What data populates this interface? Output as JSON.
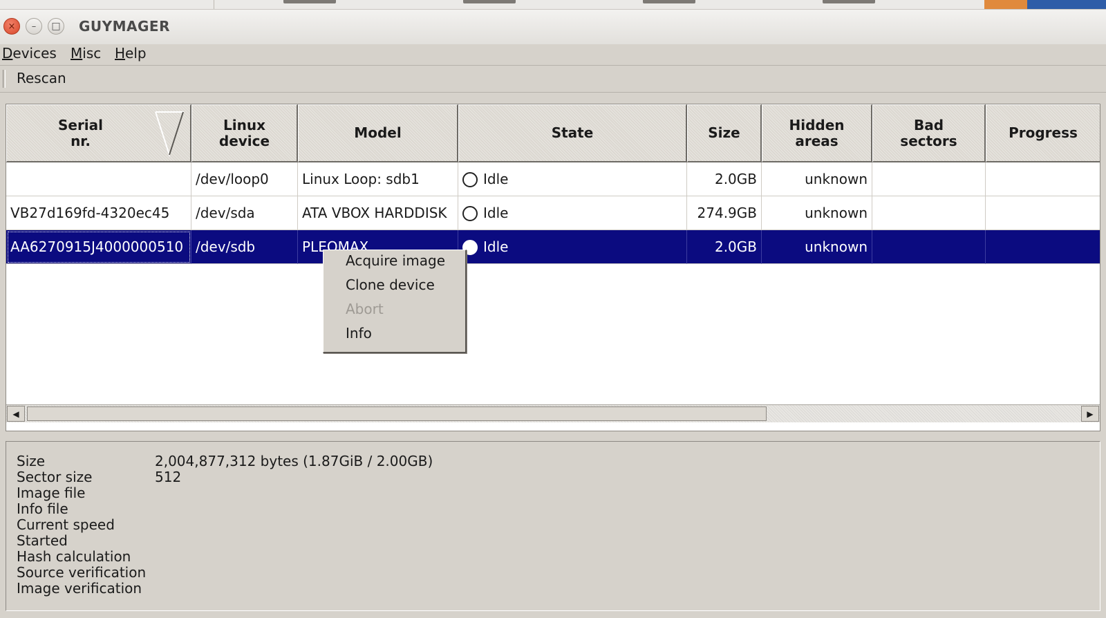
{
  "window": {
    "title": "GUYMAGER",
    "close_icon": "×",
    "min_icon": "–",
    "max_icon": "□"
  },
  "menubar": [
    {
      "first": "D",
      "rest": "evices"
    },
    {
      "first": "M",
      "rest": "isc"
    },
    {
      "first": "H",
      "rest": "elp"
    }
  ],
  "toolbar": {
    "rescan_label": "Rescan"
  },
  "table": {
    "headers": {
      "serial": "Serial\nnr.",
      "linux_device": "Linux\ndevice",
      "model": "Model",
      "state": "State",
      "size": "Size",
      "hidden_areas": "Hidden\nareas",
      "bad_sectors": "Bad\nsectors",
      "progress": "Progress"
    },
    "rows": [
      {
        "serial": "",
        "device": "/dev/loop0",
        "model": "Linux Loop: sdb1",
        "state": "Idle",
        "size": "2.0GB",
        "hidden": "unknown",
        "bad": "",
        "progress": ""
      },
      {
        "serial": "VB27d169fd-4320ec45",
        "device": "/dev/sda",
        "model": "ATA VBOX HARDDISK",
        "state": "Idle",
        "size": "274.9GB",
        "hidden": "unknown",
        "bad": "",
        "progress": ""
      },
      {
        "serial": "AA6270915J4000000510",
        "device": "/dev/sdb",
        "model": "PLEOMAX",
        "state": "Idle",
        "size": "2.0GB",
        "hidden": "unknown",
        "bad": "",
        "progress": ""
      }
    ],
    "selected_row": 2
  },
  "context_menu": {
    "acquire": "Acquire image",
    "clone": "Clone device",
    "abort": "Abort",
    "info": "Info"
  },
  "info_panel": {
    "labels": {
      "size": "Size",
      "sector_size": "Sector size",
      "image_file": "Image file",
      "info_file": "Info file",
      "current_speed": "Current speed",
      "started": "Started",
      "hash_calc": "Hash calculation",
      "source_verif": "Source verification",
      "image_verif": "Image verification"
    },
    "values": {
      "size": "2,004,877,312 bytes (1.87GiB / 2.00GB)",
      "sector_size": "512"
    }
  },
  "colors": {
    "selection": "#0b0b80",
    "window_bg": "#d6d2cb"
  }
}
